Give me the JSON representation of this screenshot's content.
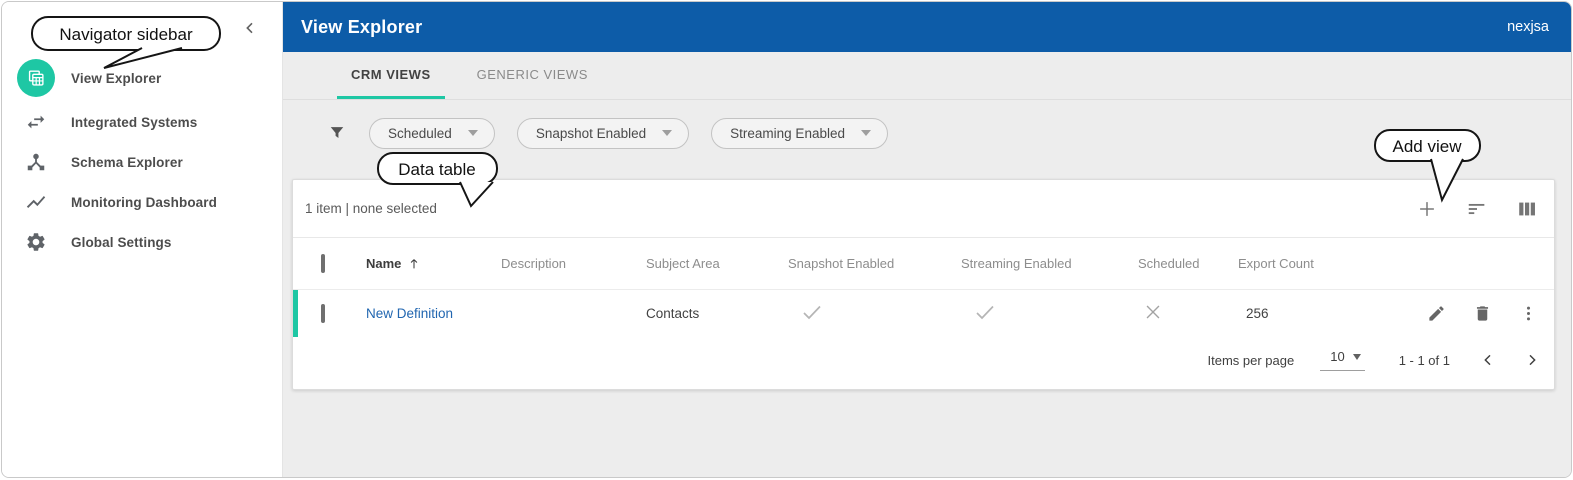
{
  "page": {
    "product_name": "nexjsa"
  },
  "header": {
    "title": "View Explorer"
  },
  "sidebar": {
    "items": [
      {
        "label": "View Explorer",
        "icon": "view-explorer-icon",
        "active": true
      },
      {
        "label": "Integrated Systems",
        "icon": "swap-arrows-icon",
        "active": false
      },
      {
        "label": "Schema Explorer",
        "icon": "schema-hub-icon",
        "active": false
      },
      {
        "label": "Monitoring Dashboard",
        "icon": "line-chart-icon",
        "active": false
      },
      {
        "label": "Global Settings",
        "icon": "gear-icon",
        "active": false
      }
    ]
  },
  "callouts": {
    "sidebar": "Navigator sidebar",
    "table": "Data table",
    "add_view": "Add view"
  },
  "tabs": [
    {
      "label": "CRM VIEWS",
      "active": true
    },
    {
      "label": "GENERIC VIEWS",
      "active": false
    }
  ],
  "filters": [
    {
      "label": "Scheduled"
    },
    {
      "label": "Snapshot Enabled"
    },
    {
      "label": "Streaming Enabled"
    }
  ],
  "table": {
    "summary": "1 item | none selected",
    "toolbar_icons": [
      "add-view",
      "sort",
      "columns"
    ],
    "columns": {
      "name": "Name",
      "description": "Description",
      "subject_area": "Subject Area",
      "snapshot_enabled": "Snapshot Enabled",
      "streaming_enabled": "Streaming Enabled",
      "scheduled": "Scheduled",
      "export_count": "Export Count"
    },
    "sort": {
      "column": "Name",
      "direction": "ascending"
    },
    "rows": [
      {
        "name": "New Definition",
        "description": "",
        "subject_area": "Contacts",
        "snapshot_enabled": true,
        "streaming_enabled": true,
        "scheduled": false,
        "export_count": "256"
      }
    ],
    "pagination": {
      "items_per_page_label": "Items per page",
      "page_size": "10",
      "range": "1 - 1 of 1"
    }
  },
  "colors": {
    "header_blue": "#0D5CA8",
    "accent_teal": "#1EC7A4",
    "link_blue": "#2166B0",
    "background_gray": "#EDEDED"
  }
}
